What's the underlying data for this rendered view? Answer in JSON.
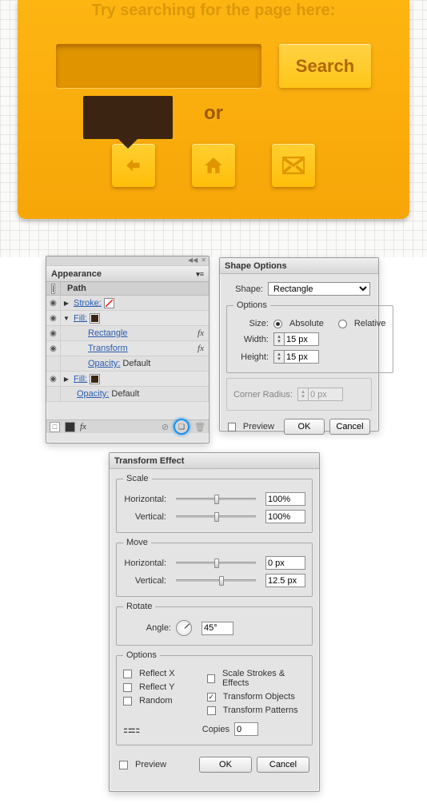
{
  "search_widget": {
    "hint": "Try searching for the page here:",
    "button": "Search",
    "divider": "or",
    "icons": [
      "back",
      "home",
      "mail"
    ]
  },
  "appearance": {
    "title": "Appearance",
    "head": "Path",
    "rows": [
      {
        "label": "Stroke:",
        "link": true,
        "badge": "slash",
        "fx": false,
        "indent": 1,
        "expand": "▶"
      },
      {
        "label": "Fill:",
        "link": true,
        "badge": "fill",
        "fx": false,
        "indent": 1,
        "expand": "▼"
      },
      {
        "label": "Rectangle",
        "link": true,
        "badge": "",
        "fx": true,
        "indent": 2,
        "expand": ""
      },
      {
        "label": "Transform",
        "link": true,
        "badge": "",
        "fx": true,
        "indent": 2,
        "expand": ""
      },
      {
        "label": "Opacity:",
        "link": true,
        "badge": "",
        "fx": false,
        "indent": 2,
        "extra": "Default",
        "expand": ""
      },
      {
        "label": "Fill:",
        "link": true,
        "badge": "fill",
        "fx": false,
        "indent": 1,
        "expand": "▶"
      },
      {
        "label": "Opacity:",
        "link": true,
        "badge": "",
        "fx": false,
        "indent": 1,
        "extra": "Default",
        "expand": ""
      }
    ],
    "foot_fx": "fx"
  },
  "shape_options": {
    "title": "Shape Options",
    "shape_label": "Shape:",
    "shape_value": "Rectangle",
    "options_legend": "Options",
    "size_label": "Size:",
    "absolute": "Absolute",
    "relative": "Relative",
    "width_label": "Width:",
    "width_value": "15 px",
    "height_label": "Height:",
    "height_value": "15 px",
    "corner_label": "Corner Radius:",
    "corner_value": "0 px",
    "preview": "Preview",
    "ok": "OK",
    "cancel": "Cancel"
  },
  "transform": {
    "title": "Transform Effect",
    "scale": {
      "legend": "Scale",
      "h_label": "Horizontal:",
      "h_val": "100%",
      "v_label": "Vertical:",
      "v_val": "100%"
    },
    "move": {
      "legend": "Move",
      "h_label": "Horizontal:",
      "h_val": "0 px",
      "v_label": "Vertical:",
      "v_val": "12.5 px"
    },
    "rotate": {
      "legend": "Rotate",
      "a_label": "Angle:",
      "a_val": "45°"
    },
    "options": {
      "legend": "Options",
      "reflect_x": "Reflect X",
      "reflect_y": "Reflect Y",
      "random": "Random",
      "scale_se": "Scale Strokes & Effects",
      "trans_obj": "Transform Objects",
      "trans_pat": "Transform Patterns",
      "copies_label": "Copies",
      "copies_val": "0"
    },
    "preview": "Preview",
    "ok": "OK",
    "cancel": "Cancel"
  }
}
